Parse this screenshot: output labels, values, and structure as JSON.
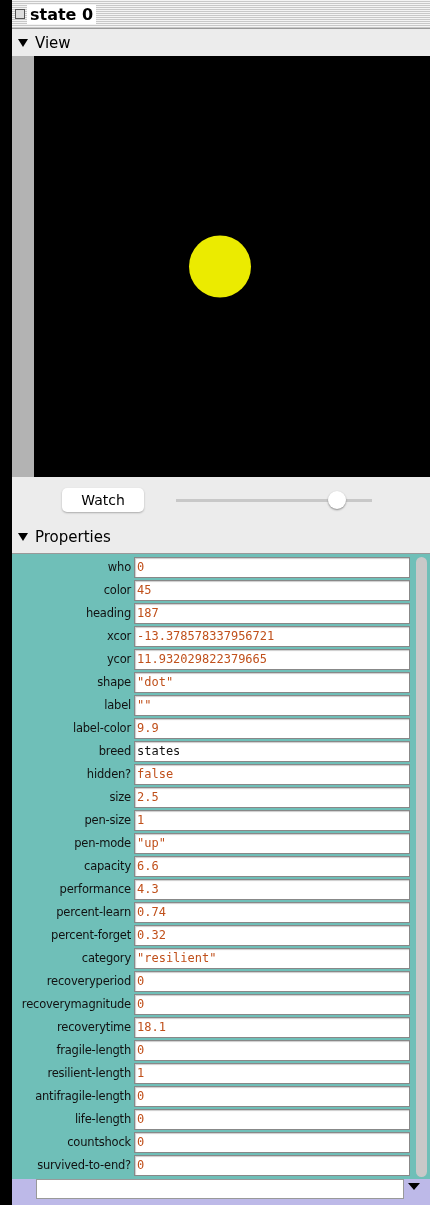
{
  "window": {
    "title": "state 0"
  },
  "view_section": {
    "title": "View",
    "expanded": true
  },
  "watch": {
    "label": "Watch"
  },
  "zoom_slider": {
    "level": 0.82
  },
  "properties_section": {
    "title": "Properties",
    "expanded": true
  },
  "properties": [
    {
      "name": "who",
      "value": "0",
      "kind": "literal"
    },
    {
      "name": "color",
      "value": "45",
      "kind": "literal"
    },
    {
      "name": "heading",
      "value": "187",
      "kind": "literal"
    },
    {
      "name": "xcor",
      "value": "-13.378578337956721",
      "kind": "literal"
    },
    {
      "name": "ycor",
      "value": "11.932029822379665",
      "kind": "literal"
    },
    {
      "name": "shape",
      "value": "\"dot\"",
      "kind": "literal"
    },
    {
      "name": "label",
      "value": "\"\"",
      "kind": "literal"
    },
    {
      "name": "label-color",
      "value": "9.9",
      "kind": "literal"
    },
    {
      "name": "breed",
      "value": "states",
      "kind": "agentset"
    },
    {
      "name": "hidden?",
      "value": "false",
      "kind": "literal"
    },
    {
      "name": "size",
      "value": "2.5",
      "kind": "literal"
    },
    {
      "name": "pen-size",
      "value": "1",
      "kind": "literal"
    },
    {
      "name": "pen-mode",
      "value": "\"up\"",
      "kind": "literal"
    },
    {
      "name": "capacity",
      "value": "6.6",
      "kind": "literal"
    },
    {
      "name": "performance",
      "value": "4.3",
      "kind": "literal"
    },
    {
      "name": "percent-learn",
      "value": "0.74",
      "kind": "literal"
    },
    {
      "name": "percent-forget",
      "value": "0.32",
      "kind": "literal"
    },
    {
      "name": "category",
      "value": "\"resilient\"",
      "kind": "literal"
    },
    {
      "name": "recoveryperiod",
      "value": "0",
      "kind": "literal"
    },
    {
      "name": "recoverymagnitude",
      "value": "0",
      "kind": "literal"
    },
    {
      "name": "recoverytime",
      "value": "18.1",
      "kind": "literal"
    },
    {
      "name": "fragile-length",
      "value": "0",
      "kind": "literal"
    },
    {
      "name": "resilient-length",
      "value": "1",
      "kind": "literal"
    },
    {
      "name": "antifragile-length",
      "value": "0",
      "kind": "literal"
    },
    {
      "name": "life-length",
      "value": "0",
      "kind": "literal"
    },
    {
      "name": "countshock",
      "value": "0",
      "kind": "literal"
    },
    {
      "name": "survived-to-end?",
      "value": "0",
      "kind": "literal"
    }
  ]
}
